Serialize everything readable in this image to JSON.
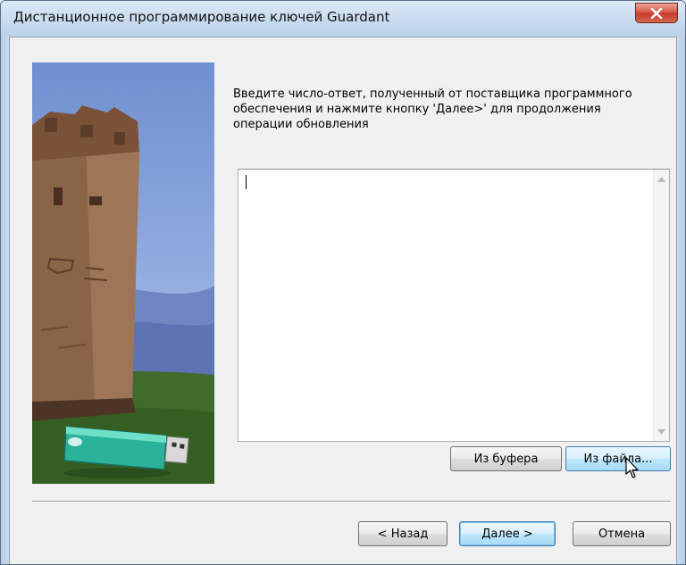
{
  "window": {
    "title": "Дистанционное программирование ключей Guardant",
    "close_symbol": "x"
  },
  "content": {
    "instruction": "Введите число-ответ, полученный от поставщика программного обеспечения и нажмите кнопку 'Далее>' для продолжения операции обновления",
    "answer_value": ""
  },
  "buttons": {
    "from_clipboard": "Из буфера",
    "from_file": "Из файла...",
    "back": "< Назад",
    "next": "Далее >",
    "cancel": "Отмена"
  },
  "icons": {
    "close": "close-icon",
    "scroll_up": "arrow-up-icon",
    "scroll_down": "arrow-down-icon",
    "cursor": "mouse-pointer-icon"
  },
  "colors": {
    "close_button": "#c43d2c",
    "accent_border": "#3c7fb1",
    "sky": "#7f9fd6",
    "grass": "#3f6b2b",
    "usb_key": "#2ab39a"
  }
}
